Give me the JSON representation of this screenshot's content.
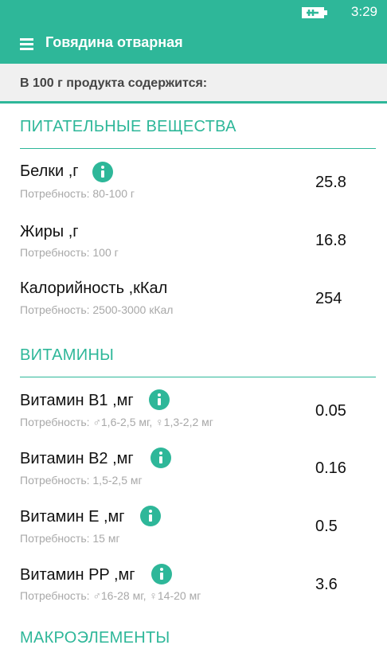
{
  "status": {
    "time": "3:29"
  },
  "header": {
    "title": "Говядина отварная"
  },
  "subheader": "В 100 г продукта содержится:",
  "sections": [
    {
      "title": "ПИТАТЕЛЬНЫЕ ВЕЩЕСТВА",
      "items": [
        {
          "name": "Белки ,г",
          "need": "Потребность:  80-100 г",
          "value": "25.8",
          "info": true
        },
        {
          "name": "Жиры ,г",
          "need": "Потребность:  100 г",
          "value": "16.8",
          "info": false
        },
        {
          "name": "Калорийность ,кКал",
          "need": "Потребность:  2500-3000 кКал",
          "value": "254",
          "info": false
        }
      ]
    },
    {
      "title": "ВИТАМИНЫ",
      "items": [
        {
          "name": "Витамин B1 ,мг",
          "need": "Потребность:  ♂1,6-2,5 мг, ♀1,3-2,2 мг",
          "value": "0.05",
          "info": true
        },
        {
          "name": "Витамин B2 ,мг",
          "need": "Потребность:  1,5-2,5 мг",
          "value": "0.16",
          "info": true
        },
        {
          "name": "Витамин E ,мг",
          "need": "Потребность:  15 мг",
          "value": "0.5",
          "info": true
        },
        {
          "name": "Витамин PP ,мг",
          "need": "Потребность:  ♂16-28 мг, ♀14-20 мг",
          "value": "3.6",
          "info": true
        }
      ]
    },
    {
      "title": "МАКРОЭЛЕМЕНТЫ",
      "items": []
    }
  ],
  "colors": {
    "accent": "#2eb799",
    "secondary_text": "#a8a8a8",
    "subheader_bg": "#f0f0f0"
  }
}
